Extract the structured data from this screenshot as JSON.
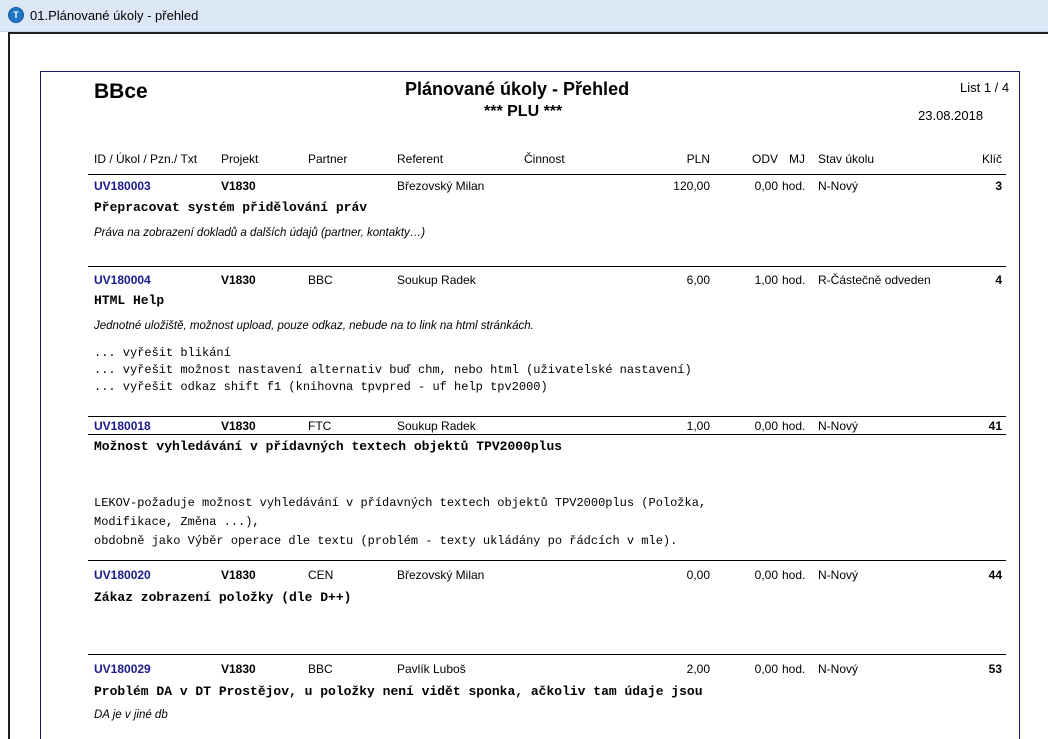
{
  "window": {
    "title": "01.Plánované úkoly - přehled"
  },
  "report": {
    "company": "BBce",
    "title": "Plánované úkoly - Přehled",
    "subtitle": "*** PLU ***",
    "sheet": "List 1 / 4",
    "date": "23.08.2018"
  },
  "columns": {
    "id": "ID / Úkol / Pzn./ Txt",
    "project": "Projekt",
    "partner": "Partner",
    "referent": "Referent",
    "activity": "Činnost",
    "pln": "PLN",
    "odv": "ODV",
    "mj": "MJ",
    "status": "Stav úkolu",
    "key": "Klíč"
  },
  "tasks": [
    {
      "id": "UV180003",
      "project": "V1830",
      "partner": "",
      "referent": "Březovský Milan",
      "pln": "120,00",
      "odv": "0,00",
      "mj": "hod.",
      "status": "N-Nový",
      "key": "3",
      "subject": "Přepracovat systém přidělování práv",
      "note": "Práva na zobrazení dokladů a dalších údajů (partner, kontakty…)",
      "text": []
    },
    {
      "id": "UV180004",
      "project": "V1830",
      "partner": "BBC",
      "referent": "Soukup Radek",
      "pln": "6,00",
      "odv": "1,00",
      "mj": "hod.",
      "status": "R-Částečně odveden",
      "key": "4",
      "subject": "HTML Help",
      "note": "Jednotné uložiště, možnost upload, pouze odkaz, nebude na to link na html stránkách.",
      "text": [
        "... vyřešit blikání",
        "... vyřešit možnost nastavení alternativ buď chm, nebo html (uživatelské nastavení)",
        "... vyřešit odkaz shift f1 (knihovna tpvpred - uf help tpv2000)"
      ]
    },
    {
      "id": "UV180018",
      "project": "V1830",
      "partner": "FTC",
      "referent": "Soukup Radek",
      "pln": "1,00",
      "odv": "0,00",
      "mj": "hod.",
      "status": "N-Nový",
      "key": "41",
      "subject": "Možnost vyhledávání v přídavných textech objektů TPV2000plus",
      "note": "",
      "text": [
        "LEKOV-požaduje možnost vyhledávání v přídavných textech objektů TPV2000plus (Položka,",
        "Modifikace, Změna ...),",
        "obdobně jako Výběr operace dle textu (problém - texty ukládány po řádcích v mle)."
      ]
    },
    {
      "id": "UV180020",
      "project": "V1830",
      "partner": "CEN",
      "referent": "Březovský Milan",
      "pln": "0,00",
      "odv": "0,00",
      "mj": "hod.",
      "status": "N-Nový",
      "key": "44",
      "subject": "Zákaz zobrazení položky (dle D++)",
      "note": "",
      "text": []
    },
    {
      "id": "UV180029",
      "project": "V1830",
      "partner": "BBC",
      "referent": "Pavlík Luboš",
      "pln": "2,00",
      "odv": "0,00",
      "mj": "hod.",
      "status": "N-Nový",
      "key": "53",
      "subject": "Problém DA v DT Prostějov, u položky není vidět sponka, ačkoliv tam údaje jsou",
      "note": "DA je v jiné db",
      "text": []
    }
  ]
}
